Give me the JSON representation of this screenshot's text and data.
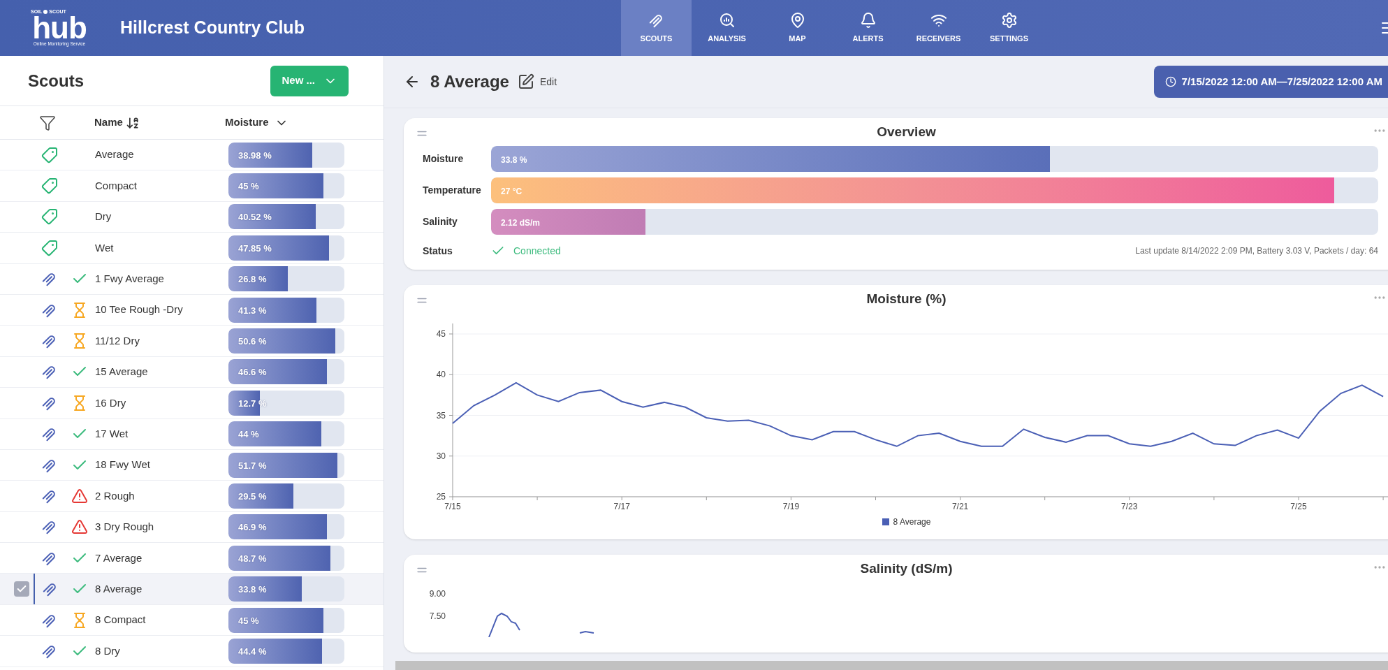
{
  "header": {
    "logo": {
      "brand_left": "SOIL",
      "brand_right": "SCOUT",
      "brand": "hub",
      "tagline": "Online Monitoring Service"
    },
    "site_title": "Hillcrest Country Club",
    "nav": [
      {
        "kind": "scouts",
        "label": "SCOUTS",
        "selected": true
      },
      {
        "kind": "analysis",
        "label": "ANALYSIS",
        "selected": false
      },
      {
        "kind": "map",
        "label": "MAP",
        "selected": false
      },
      {
        "kind": "alerts",
        "label": "ALERTS",
        "selected": false
      },
      {
        "kind": "receivers",
        "label": "RECEIVERS",
        "selected": false
      },
      {
        "kind": "settings",
        "label": "SETTINGS",
        "selected": false
      }
    ]
  },
  "scouts_panel": {
    "title": "Scouts",
    "new_button": "New ...",
    "columns": [
      "Name",
      "Moisture"
    ],
    "rows": [
      {
        "kind": "group",
        "name": "Average",
        "reading": "38.98 %",
        "level": 0.72,
        "selected": false
      },
      {
        "kind": "group",
        "name": "Compact",
        "reading": "45 %",
        "level": 0.82,
        "selected": false
      },
      {
        "kind": "group",
        "name": "Dry",
        "reading": "40.52 %",
        "level": 0.75,
        "selected": false
      },
      {
        "kind": "group",
        "name": "Wet",
        "reading": "47.85 %",
        "level": 0.87,
        "selected": false
      },
      {
        "kind": "scout_ok",
        "name": "1 Fwy Average",
        "reading": "26.8 %",
        "level": 0.51,
        "selected": false
      },
      {
        "kind": "scout_pending",
        "name": "10 Tee Rough -Dry",
        "reading": "41.3 %",
        "level": 0.76,
        "selected": false
      },
      {
        "kind": "scout_pending",
        "name": "11/12 Dry",
        "reading": "50.6 %",
        "level": 0.92,
        "selected": false
      },
      {
        "kind": "scout_ok",
        "name": "15 Average",
        "reading": "46.6 %",
        "level": 0.85,
        "selected": false
      },
      {
        "kind": "scout_pending",
        "name": "16 Dry",
        "reading": "12.7 %",
        "level": 0.27,
        "selected": false
      },
      {
        "kind": "scout_ok",
        "name": "17 Wet",
        "reading": "44 %",
        "level": 0.8,
        "selected": false
      },
      {
        "kind": "scout_ok",
        "name": "18 Fwy Wet",
        "reading": "51.7 %",
        "level": 0.94,
        "selected": false
      },
      {
        "kind": "scout_alert",
        "name": "2 Rough",
        "reading": "29.5 %",
        "level": 0.56,
        "selected": false
      },
      {
        "kind": "scout_alert",
        "name": "3 Dry Rough",
        "reading": "46.9 %",
        "level": 0.85,
        "selected": false
      },
      {
        "kind": "scout_ok",
        "name": "7 Average",
        "reading": "48.7 %",
        "level": 0.88,
        "selected": false
      },
      {
        "kind": "scout_ok",
        "name": "8 Average",
        "reading": "33.8 %",
        "level": 0.63,
        "selected": true
      },
      {
        "kind": "scout_pending",
        "name": "8 Compact",
        "reading": "45 %",
        "level": 0.82,
        "selected": false
      },
      {
        "kind": "scout_ok",
        "name": "8 Dry",
        "reading": "44.4 %",
        "level": 0.81,
        "selected": false
      }
    ]
  },
  "detail": {
    "title": "8 Average",
    "edit": "Edit",
    "date_range": "7/15/2022 12:00 AM—7/25/2022 12:00 AM",
    "overview": {
      "title": "Overview",
      "metrics": [
        {
          "kind": "moisture",
          "label": "Moisture",
          "reading": "33.8 %",
          "level": 0.63
        },
        {
          "kind": "temperature",
          "label": "Temperature",
          "reading": "27 °C",
          "level": 0.95
        },
        {
          "kind": "salinity",
          "label": "Salinity",
          "reading": "2.12 dS/m",
          "level": 0.174
        }
      ],
      "status_label": "Status",
      "status": "Connected",
      "last_update": "Last update 8/14/2022 2:09 PM, Battery 3.03 V, Packets / day: 64"
    },
    "moisture_chart": {
      "title": "Moisture (%)",
      "chart_data": {
        "type": "line",
        "categories": [
          "7/15",
          null,
          null,
          null,
          null,
          null,
          null,
          null,
          "7/17",
          null,
          null,
          null,
          null,
          null,
          null,
          null,
          "7/19",
          null,
          null,
          null,
          null,
          null,
          null,
          null,
          "7/21",
          null,
          null,
          null,
          null,
          null,
          null,
          null,
          "7/23",
          null,
          null,
          null,
          null,
          null,
          null,
          null,
          "7/25",
          null,
          null,
          null,
          null
        ],
        "series": [
          {
            "name": "8 Average",
            "color": "#4a5fb5",
            "values": [
              34,
              36.2,
              37.5,
              39,
              37.5,
              36.7,
              37.8,
              38.1,
              36.7,
              36,
              36.6,
              36,
              34.7,
              34.3,
              34.4,
              33.7,
              32.5,
              32,
              33,
              33,
              32,
              31.2,
              32.5,
              32.8,
              31.8,
              31.2,
              31.2,
              33.3,
              32.3,
              31.7,
              32.5,
              32.5,
              31.5,
              31.2,
              31.8,
              32.8,
              31.5,
              31.3,
              32.5,
              33.2,
              32.2,
              35.5,
              37.7,
              38.7,
              37.3
            ]
          }
        ],
        "ylim": [
          25,
          45
        ],
        "grid": true,
        "yticks": [
          25,
          30,
          35,
          40,
          45
        ]
      }
    },
    "salinity_chart": {
      "title": "Salinity (dS/m)",
      "y_axis_labels": [
        "9.00",
        "7.50"
      ]
    }
  }
}
